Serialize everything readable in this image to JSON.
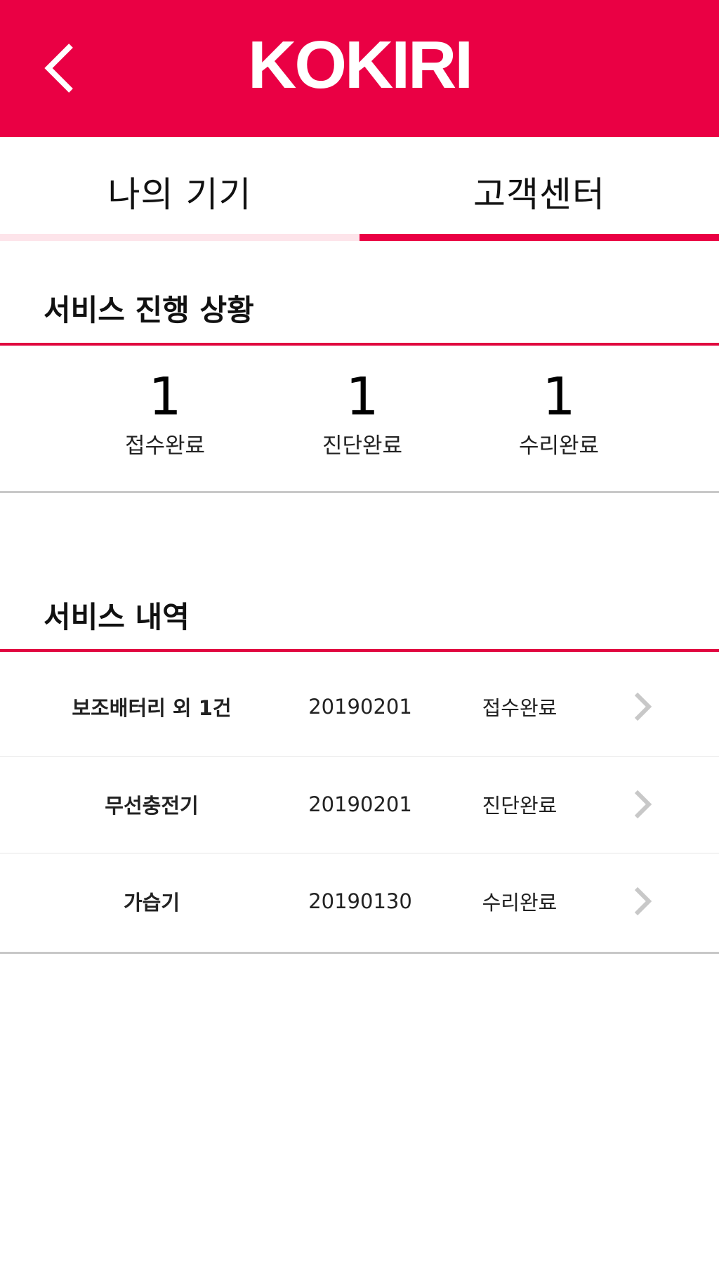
{
  "colors": {
    "brand": "#ea0044",
    "tab_inactive_bar": "#fde4ea",
    "divider": "#c8c8c8",
    "chevron": "#c8c8c8"
  },
  "header": {
    "logo": "KOKIRI",
    "back_icon": "chevron-left-icon"
  },
  "tabs": [
    {
      "label": "나의 기기",
      "active": false
    },
    {
      "label": "고객센터",
      "active": true
    }
  ],
  "progress": {
    "title": "서비스 진행 상황",
    "stats": [
      {
        "count": "1",
        "label": "접수완료"
      },
      {
        "count": "1",
        "label": "진단완료"
      },
      {
        "count": "1",
        "label": "수리완료"
      }
    ]
  },
  "history": {
    "title": "서비스 내역",
    "rows": [
      {
        "name": "보조배터리 외 1건",
        "date": "20190201",
        "status": "접수완료"
      },
      {
        "name": "무선충전기",
        "date": "20190201",
        "status": "진단완료"
      },
      {
        "name": "가습기",
        "date": "20190130",
        "status": "수리완료"
      }
    ],
    "row_icon": "chevron-right-icon"
  }
}
